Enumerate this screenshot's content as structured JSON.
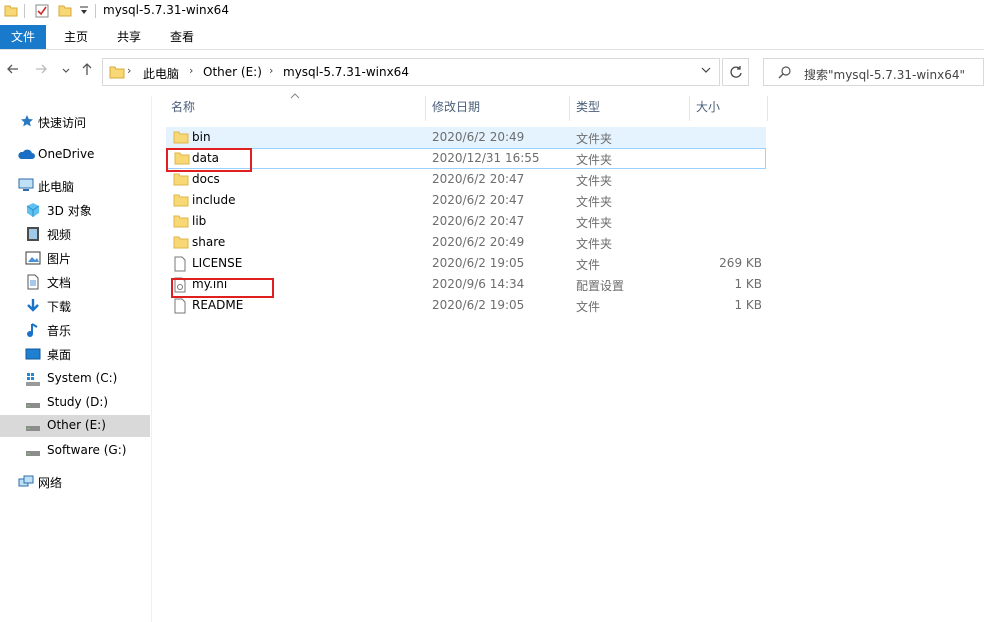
{
  "window": {
    "title": "mysql-5.7.31-winx64",
    "quick_access_icons": [
      "folder-icon",
      "checkbox-properties-icon",
      "new-folder-icon",
      "customize-dropdown-icon"
    ]
  },
  "ribbon": {
    "file_tab": "文件",
    "tabs": [
      "主页",
      "共享",
      "查看"
    ]
  },
  "address": {
    "breadcrumbs": [
      "此电脑",
      "Other (E:)",
      "mysql-5.7.31-winx64"
    ],
    "search_placeholder": "搜索\"mysql-5.7.31-winx64\""
  },
  "navigation": {
    "quick_access": "快速访问",
    "onedrive": "OneDrive",
    "this_pc": "此电脑",
    "items": [
      {
        "label": "3D 对象",
        "icon": "3d-objects-icon"
      },
      {
        "label": "视频",
        "icon": "video-icon"
      },
      {
        "label": "图片",
        "icon": "pictures-icon"
      },
      {
        "label": "文档",
        "icon": "documents-icon"
      },
      {
        "label": "下载",
        "icon": "downloads-icon"
      },
      {
        "label": "音乐",
        "icon": "music-icon"
      },
      {
        "label": "桌面",
        "icon": "desktop-icon"
      },
      {
        "label": "System (C:)",
        "icon": "system-drive-icon"
      },
      {
        "label": "Study (D:)",
        "icon": "drive-icon"
      },
      {
        "label": "Other (E:)",
        "icon": "drive-icon"
      },
      {
        "label": "Software (G:)",
        "icon": "drive-icon"
      }
    ],
    "network": "网络",
    "selected": "Other (E:)"
  },
  "columns": {
    "name": "名称",
    "date": "修改日期",
    "type": "类型",
    "size": "大小"
  },
  "files": [
    {
      "name": "bin",
      "date": "2020/6/2 20:49",
      "type": "文件夹",
      "size": "",
      "icon": "folder-icon"
    },
    {
      "name": "data",
      "date": "2020/12/31 16:55",
      "type": "文件夹",
      "size": "",
      "icon": "folder-icon"
    },
    {
      "name": "docs",
      "date": "2020/6/2 20:47",
      "type": "文件夹",
      "size": "",
      "icon": "folder-icon"
    },
    {
      "name": "include",
      "date": "2020/6/2 20:47",
      "type": "文件夹",
      "size": "",
      "icon": "folder-icon"
    },
    {
      "name": "lib",
      "date": "2020/6/2 20:47",
      "type": "文件夹",
      "size": "",
      "icon": "folder-icon"
    },
    {
      "name": "share",
      "date": "2020/6/2 20:49",
      "type": "文件夹",
      "size": "",
      "icon": "folder-icon"
    },
    {
      "name": "LICENSE",
      "date": "2020/6/2 19:05",
      "type": "文件",
      "size": "269 KB",
      "icon": "file-icon"
    },
    {
      "name": "my.ini",
      "date": "2020/9/6 14:34",
      "type": "配置设置",
      "size": "1 KB",
      "icon": "config-file-icon"
    },
    {
      "name": "README",
      "date": "2020/6/2 19:05",
      "type": "文件",
      "size": "1 KB",
      "icon": "file-icon"
    }
  ],
  "colors": {
    "file_tab_bg": "#1979ca",
    "highlight_box": "#e02020",
    "folder_yellow": "#f8d775",
    "selected_row": "#e5f3ff"
  }
}
